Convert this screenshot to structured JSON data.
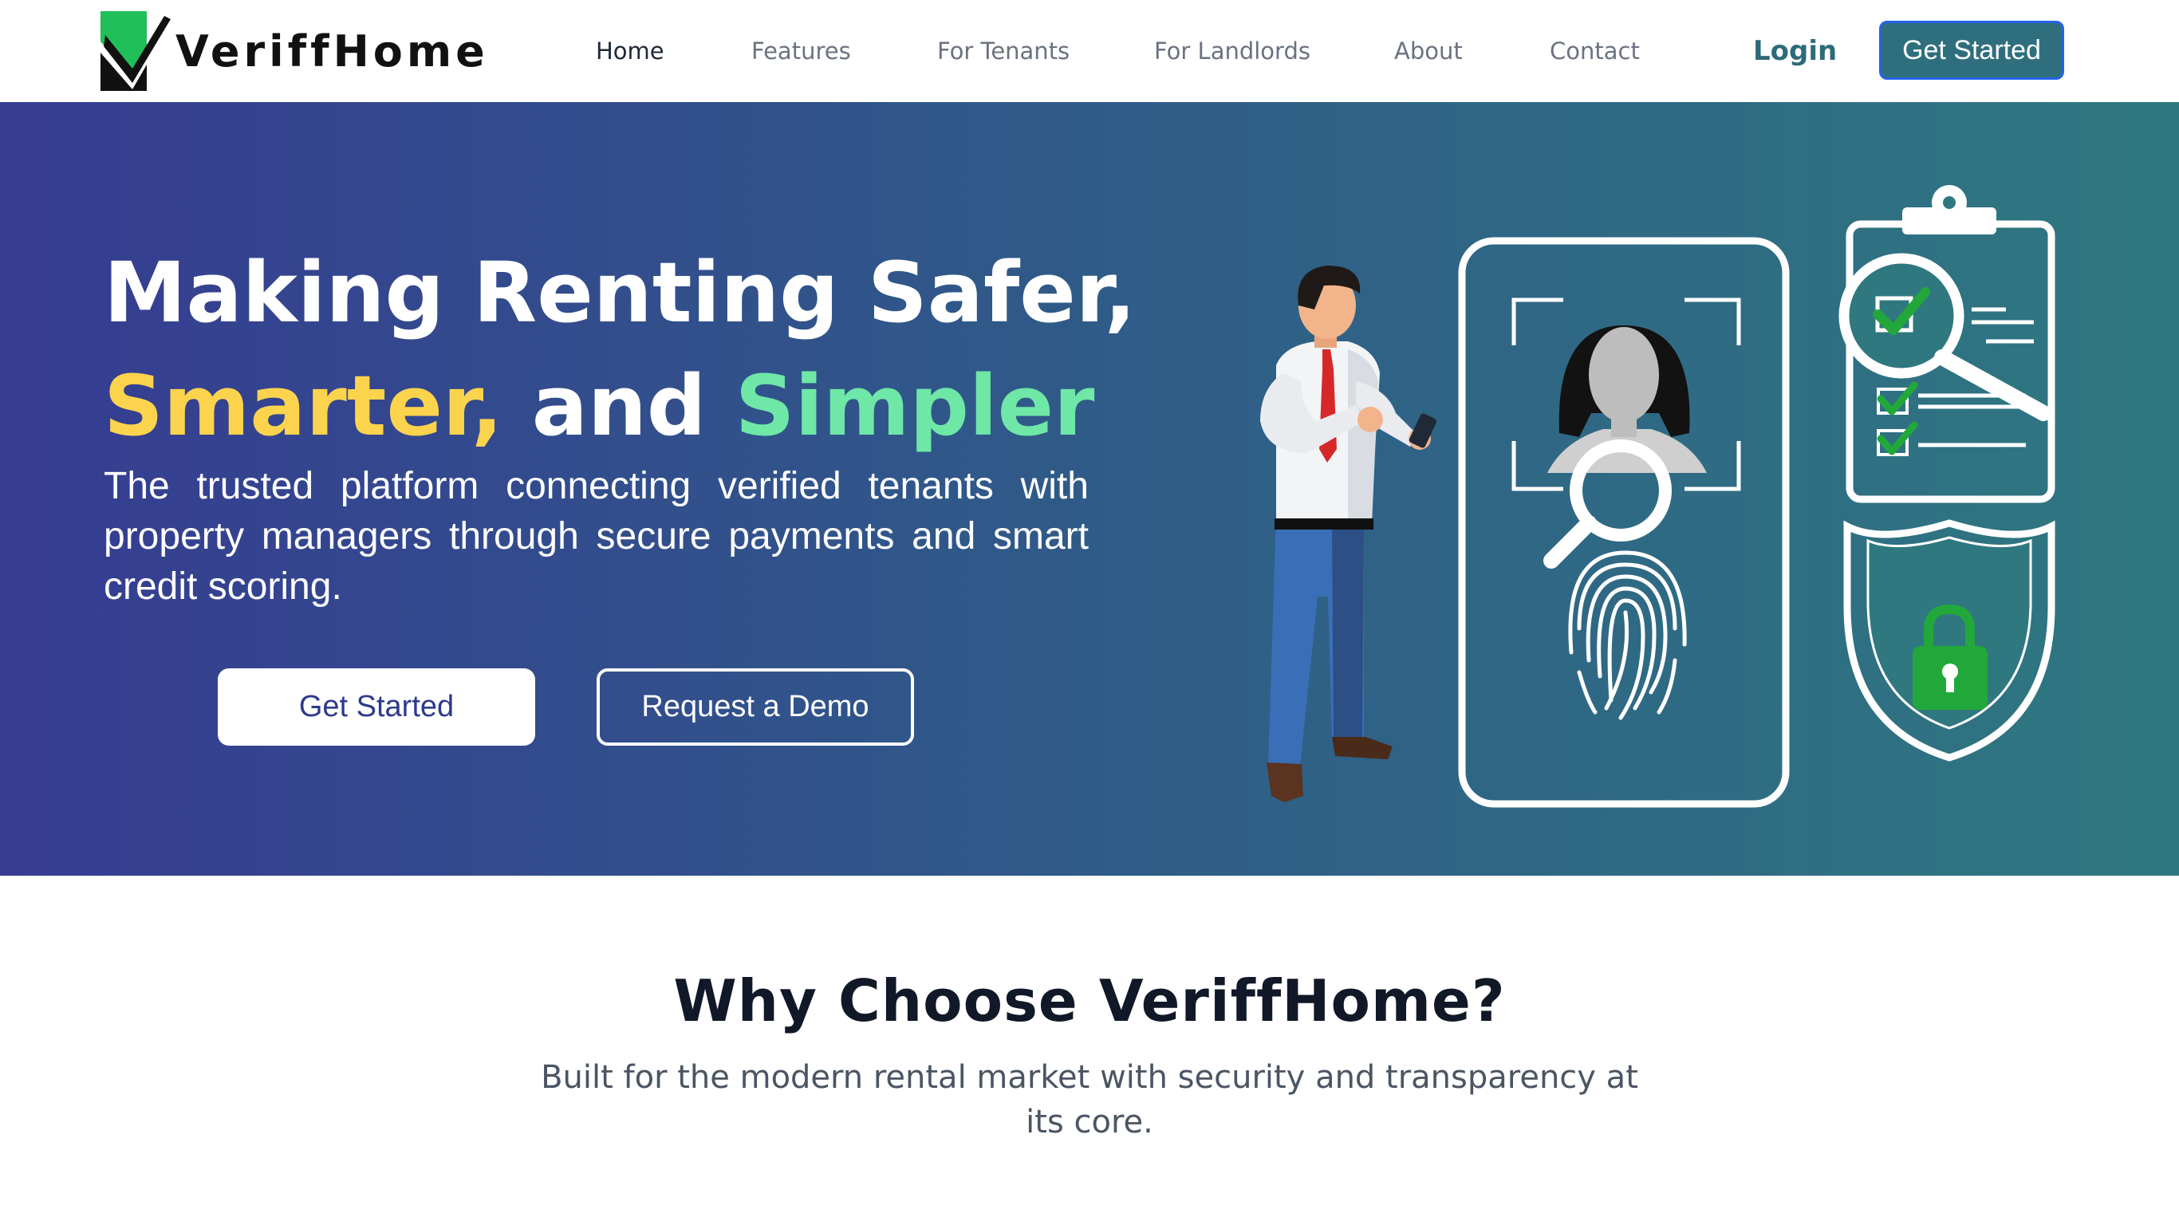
{
  "brand": {
    "name": "VeriffHome"
  },
  "nav": {
    "links": [
      {
        "label": "Home",
        "active": true
      },
      {
        "label": "Features"
      },
      {
        "label": "For Tenants"
      },
      {
        "label": "For Landlords"
      },
      {
        "label": "About"
      },
      {
        "label": "Contact"
      }
    ],
    "login_label": "Login",
    "cta_label": "Get Started"
  },
  "hero": {
    "title_line1": "Making Renting Safer,",
    "title_word_smarter": "Smarter,",
    "title_word_and": " and ",
    "title_word_simpler": "Simpler",
    "subtitle": "The trusted platform connecting verified tenants with property managers through secure payments and smart credit scoring.",
    "primary_button": "Get Started",
    "secondary_button": "Request a Demo"
  },
  "why": {
    "title": "Why Choose VeriffHome?",
    "subtitle": "Built for the modern rental market with security and transparency at its core."
  },
  "colors": {
    "accent_teal": "#2f6f7d",
    "hero_gradient_start": "#363c92",
    "hero_gradient_end": "#2f7880",
    "highlight_yellow": "#fcd34d",
    "highlight_green": "#6ee7a7",
    "check_green": "#22a83a"
  },
  "icons": [
    "logo-check-icon",
    "magnifier-icon",
    "fingerprint-icon",
    "clipboard-icon",
    "checkmark-icon",
    "shield-icon",
    "padlock-icon",
    "phone-icon"
  ]
}
